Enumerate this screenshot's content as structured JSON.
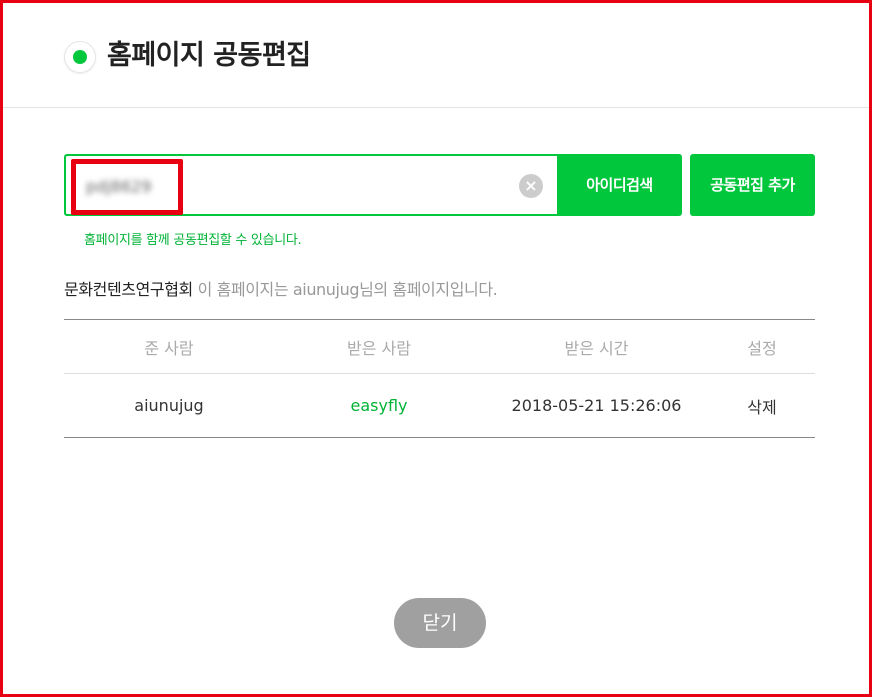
{
  "dialog": {
    "title": "홈페이지 공동편집"
  },
  "search": {
    "value": "pdj8629",
    "search_button_label": "아이디검색",
    "add_button_label": "공동편집 추가",
    "help_text": "홈페이지를 함께 공동편집할 수 있습니다."
  },
  "info": {
    "org_name": "문화컨텐츠연구협회",
    "description": " 이 홈페이지는 aiunujug님의 홈페이지입니다."
  },
  "table": {
    "headers": [
      "준 사람",
      "받은 사람",
      "받은 시간",
      "설정"
    ],
    "rows": [
      {
        "giver": "aiunujug",
        "receiver": "easyfly",
        "time": "2018-05-21 15:26:06",
        "action": "삭제"
      }
    ]
  },
  "footer": {
    "close_label": "닫기"
  },
  "colors": {
    "accent": "#00c73c",
    "highlight": "#e60012"
  }
}
